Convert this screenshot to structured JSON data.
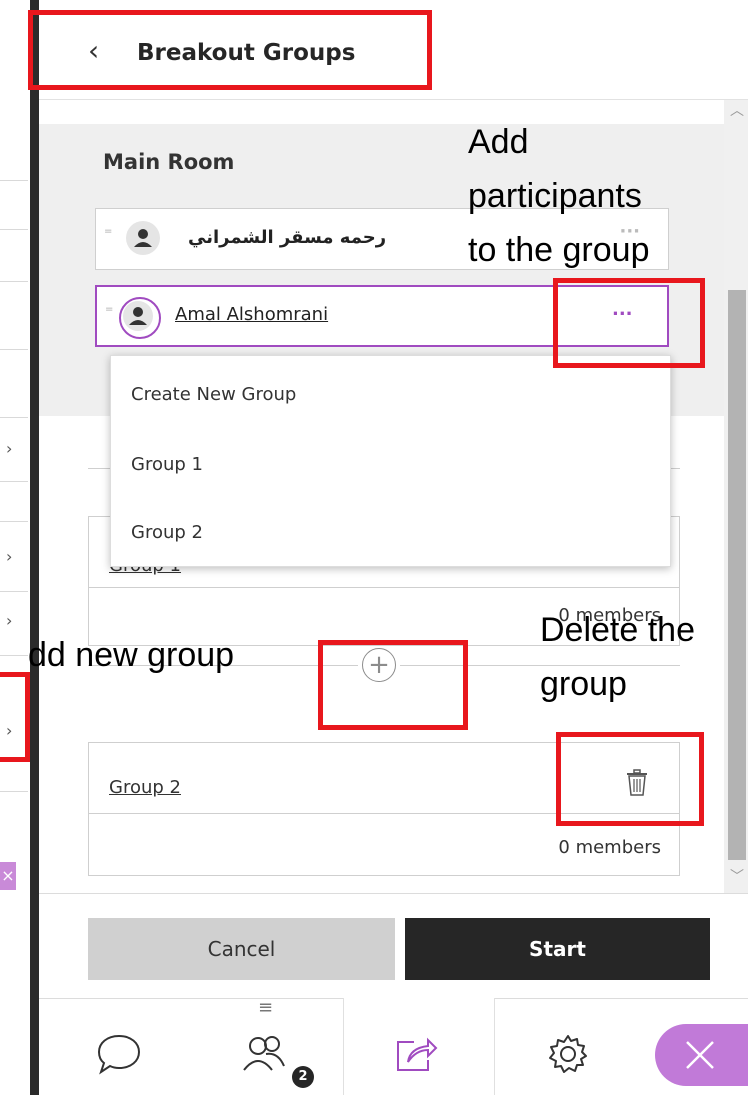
{
  "header": {
    "title": "Breakout Groups"
  },
  "main_room": {
    "title": "Main Room",
    "participants": [
      {
        "name": "رحمه مسقر الشمراني"
      },
      {
        "name": "Amal Alshomrani",
        "more_label": "..."
      }
    ]
  },
  "context_menu": {
    "items": [
      "Create New Group",
      "Group 1",
      "Group 2"
    ]
  },
  "groups": [
    {
      "name": "Group 1",
      "members": "0 members"
    },
    {
      "name": "Group 2",
      "members": "0 members"
    }
  ],
  "buttons": {
    "cancel": "Cancel",
    "start": "Start"
  },
  "bottom_nav": {
    "attendees_badge": "2"
  },
  "annotations": {
    "add_participants": [
      "Add",
      "participants",
      "to the group"
    ],
    "add_new_group": "dd new group",
    "delete_group": [
      "Delete the",
      "group"
    ]
  },
  "colors": {
    "accent": "#a04bc0",
    "annotation_red": "#e8171d",
    "start_bg": "#262626"
  }
}
